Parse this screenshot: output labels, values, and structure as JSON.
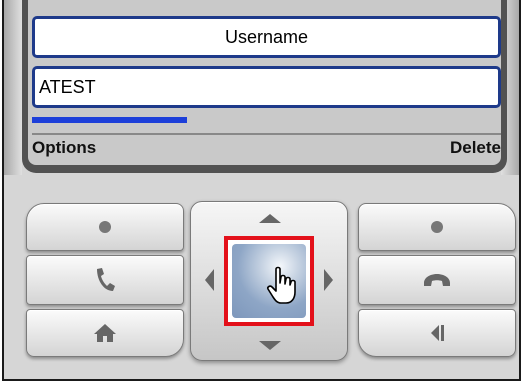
{
  "screen": {
    "fields": [
      {
        "label": "Username"
      },
      {
        "value": "ATEST"
      }
    ],
    "progress_fraction": 0.33,
    "softkeys": {
      "left": "Options",
      "right": "Delete"
    }
  },
  "keypad": {
    "left_keys": [
      "dot-icon",
      "call-icon",
      "home-icon"
    ],
    "right_keys": [
      "dot-icon",
      "end-call-icon",
      "back-icon"
    ],
    "dpad": [
      "up-arrow-icon",
      "down-arrow-icon",
      "left-arrow-icon",
      "right-arrow-icon",
      "center-select-button"
    ],
    "highlight_color": "#e3101a",
    "cursor": "hand-pointer-icon"
  },
  "colors": {
    "field_border": "#1e3a8a",
    "progress": "#1d3fd9",
    "screen_bg": "#c9c9c9"
  }
}
